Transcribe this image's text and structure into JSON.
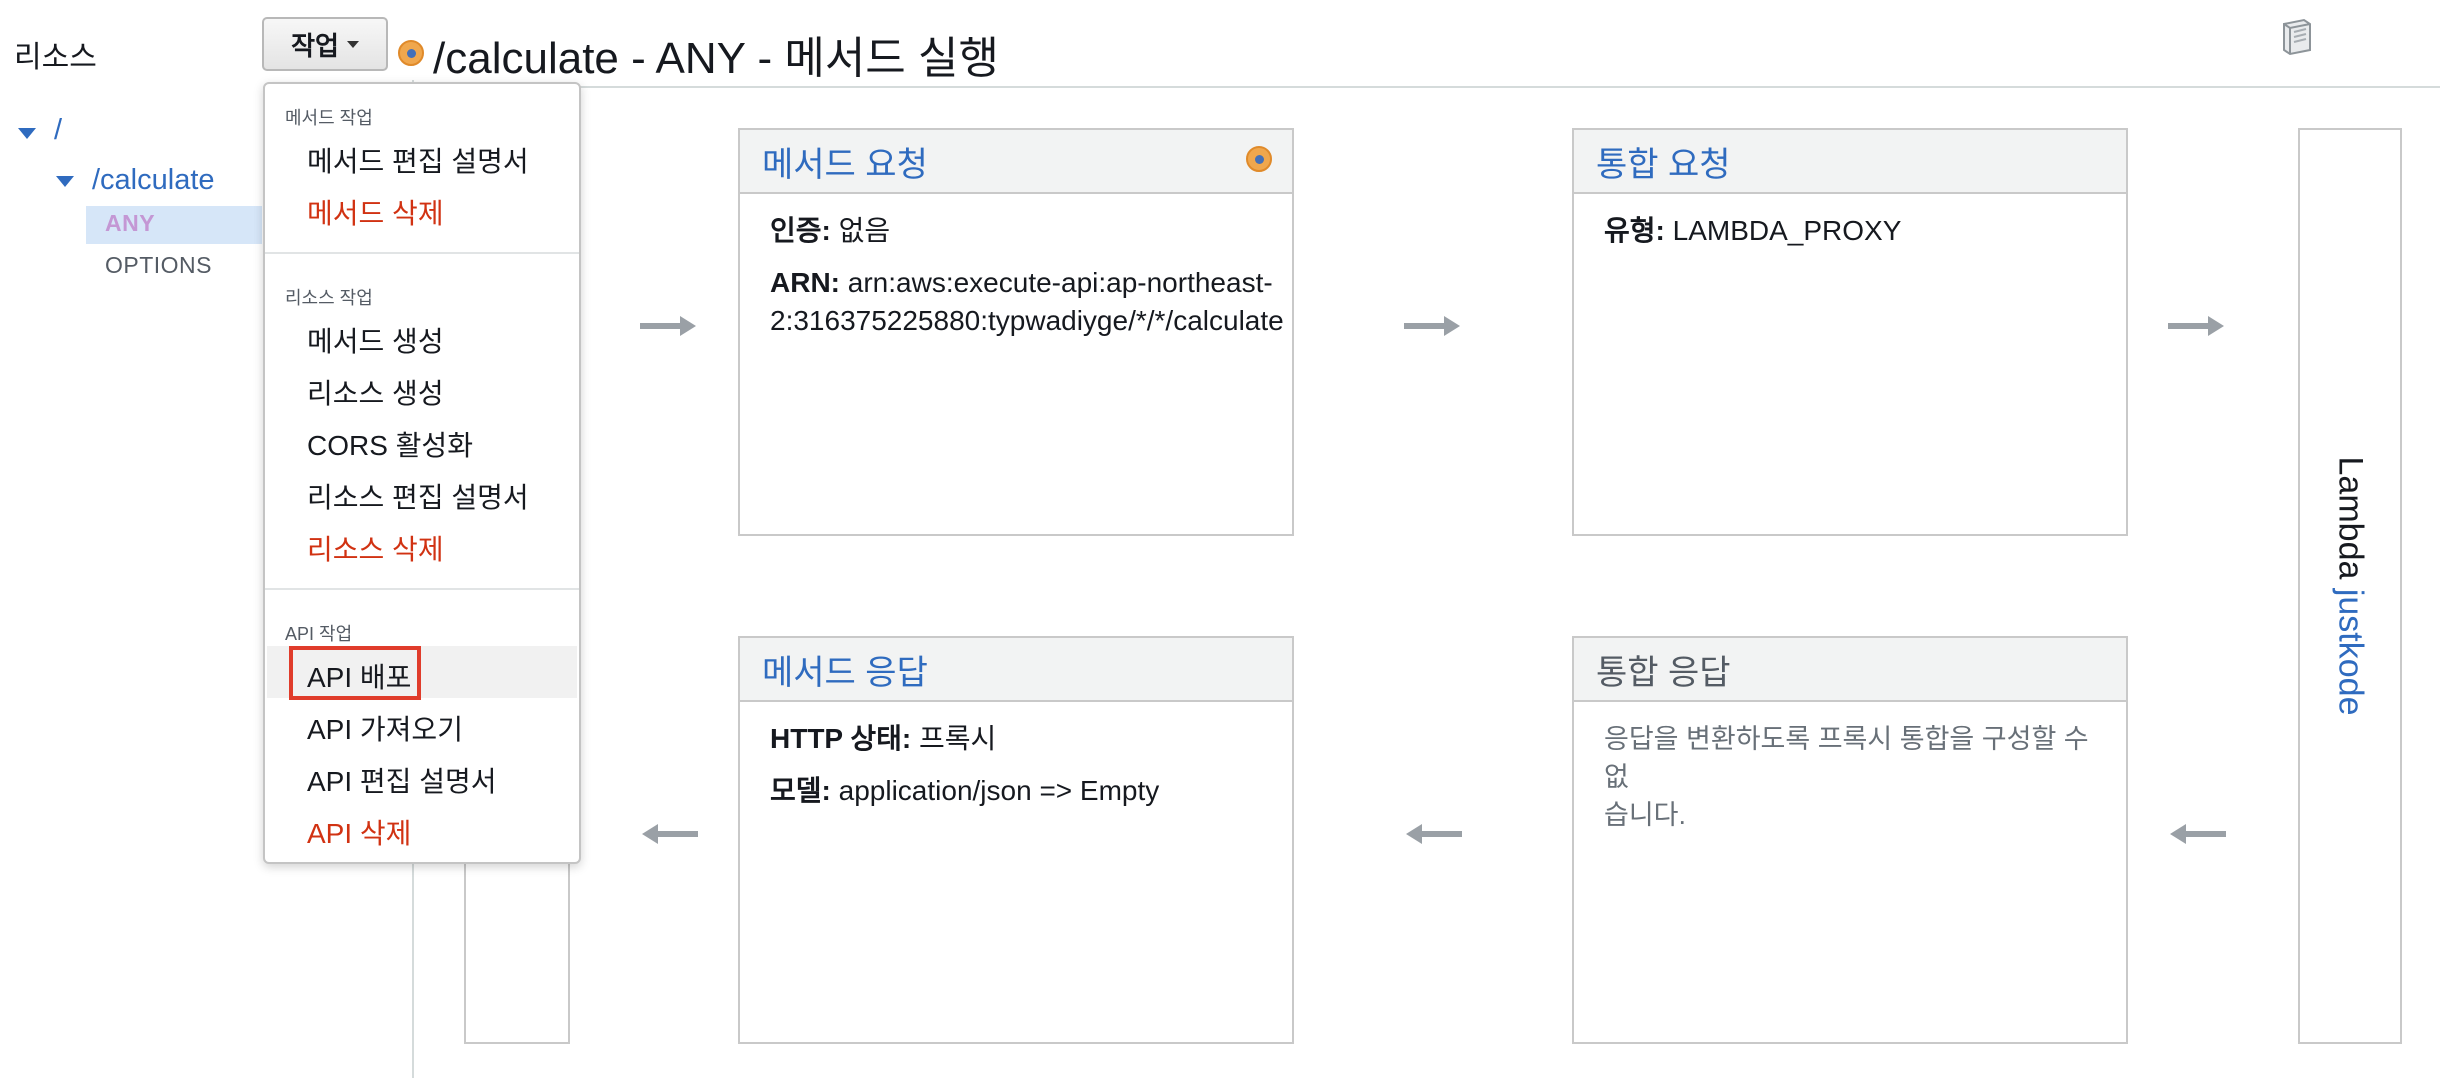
{
  "sidebar": {
    "title": "리소스",
    "tree": {
      "root": "/",
      "resource": "/calculate",
      "methods": [
        "ANY",
        "OPTIONS"
      ]
    }
  },
  "toolbar": {
    "actions_label": "작업"
  },
  "header": {
    "title": "/calculate - ANY - 메서드 실행"
  },
  "menu": {
    "groups": [
      {
        "label": "메서드 작업",
        "items": [
          {
            "label": "메서드 편집 설명서",
            "danger": false
          },
          {
            "label": "메서드 삭제",
            "danger": true
          }
        ]
      },
      {
        "label": "리소스 작업",
        "items": [
          {
            "label": "메서드 생성",
            "danger": false
          },
          {
            "label": "리소스 생성",
            "danger": false
          },
          {
            "label": "CORS 활성화",
            "danger": false
          },
          {
            "label": "리소스 편집 설명서",
            "danger": false
          },
          {
            "label": "리소스 삭제",
            "danger": true
          }
        ]
      },
      {
        "label": "API 작업",
        "items": [
          {
            "label": "API 배포",
            "danger": false,
            "highlighted": true
          },
          {
            "label": "API 가져오기",
            "danger": false
          },
          {
            "label": "API 편집 설명서",
            "danger": false
          },
          {
            "label": "API 삭제",
            "danger": true
          }
        ]
      }
    ]
  },
  "cards": {
    "method_request": {
      "title": "메서드 요청",
      "auth_label": "인증:",
      "auth_value": "없음",
      "arn_label": "ARN:",
      "arn_value_line1": "arn:aws:execute-api:ap-northeast-",
      "arn_value_line2": "2:316375225880:typwadiyge/*/*/calculate"
    },
    "integration_request": {
      "title": "통합 요청",
      "type_label": "유형:",
      "type_value": "LAMBDA_PROXY"
    },
    "method_response": {
      "title": "메서드 응답",
      "status_label": "HTTP 상태:",
      "status_value": "프록시",
      "model_label": "모델:",
      "model_value": "application/json => Empty"
    },
    "integration_response": {
      "title": "통합 응답",
      "message_line1": "응답을 변환하도록 프록시 통합을 구성할 수 없",
      "message_line2": "습니다."
    }
  },
  "lambda": {
    "label": "Lambda",
    "function_name": "justkode"
  },
  "colors": {
    "link": "#2f6bbf",
    "danger": "#d13212",
    "highlight": "#e03c2b",
    "method_dot": "#f0a74d"
  }
}
